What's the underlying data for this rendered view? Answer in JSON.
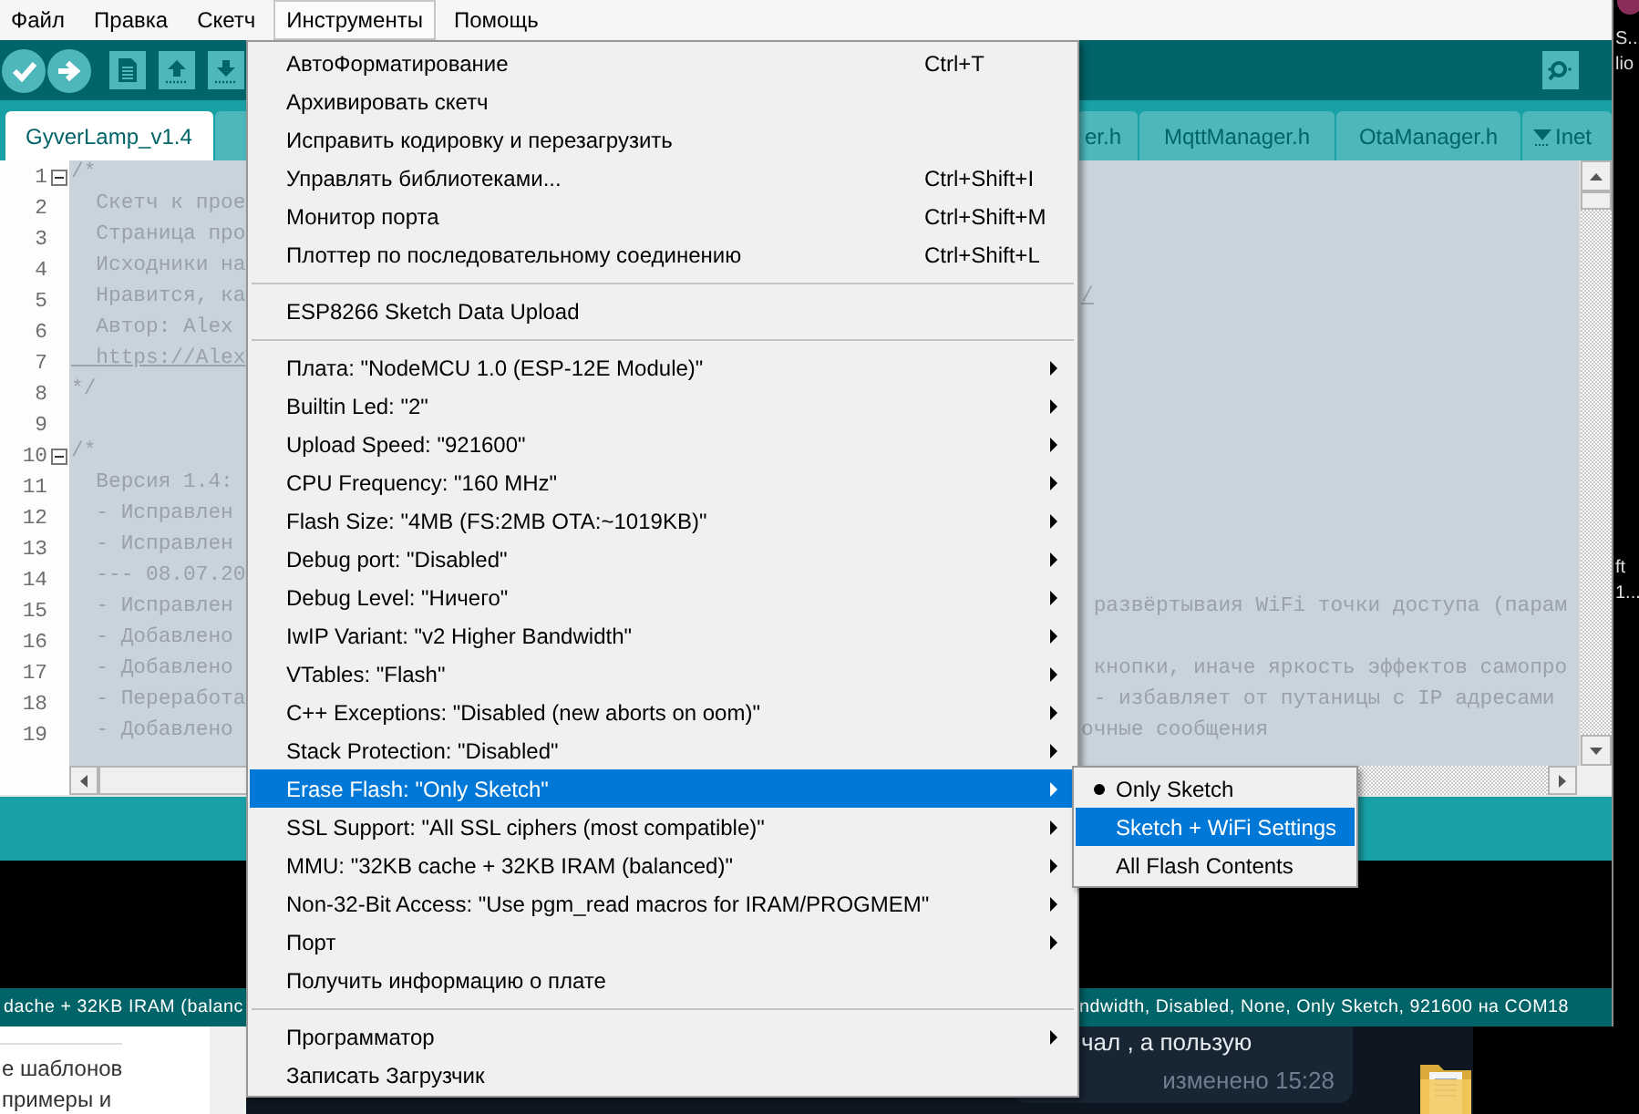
{
  "menubar": [
    {
      "label": "Файл",
      "selected": false
    },
    {
      "label": "Правка",
      "selected": false
    },
    {
      "label": "Скетч",
      "selected": false
    },
    {
      "label": "Инструменты",
      "selected": true
    },
    {
      "label": "Помощь",
      "selected": false
    }
  ],
  "tabs": [
    {
      "kind": "file",
      "label": "GyverLamp_v1.4",
      "selected": true
    },
    {
      "kind": "file",
      "selected": false
    },
    {
      "kind": "file",
      "label": "er.h",
      "selected": false
    },
    {
      "kind": "file",
      "label": "MqttManager.h",
      "selected": false
    },
    {
      "kind": "file",
      "label": "OtaManager.h",
      "selected": false
    },
    {
      "kind": "more",
      "label": "Inet",
      "selected": false
    }
  ],
  "editor": {
    "lines": [
      {
        "number": "1",
        "fold": true,
        "parts": [
          {
            "text": "/*",
            "link": false
          }
        ]
      },
      {
        "number": "2",
        "fold": false,
        "parts": [
          {
            "text": "  Скетч к прое",
            "link": false
          }
        ]
      },
      {
        "number": "3",
        "fold": false,
        "parts": [
          {
            "text": "  Страница про",
            "link": false
          }
        ]
      },
      {
        "number": "4",
        "fold": false,
        "parts": [
          {
            "text": "  Исходники на",
            "link": false
          }
        ]
      },
      {
        "number": "5",
        "fold": false,
        "parts": [
          {
            "text": "  Нравится, ка",
            "link": false
          },
          {
            "text": "/",
            "link": true
          }
        ]
      },
      {
        "number": "6",
        "fold": false,
        "parts": [
          {
            "text": "  Автор: Alex",
            "link": false
          }
        ]
      },
      {
        "number": "7",
        "fold": false,
        "parts": [
          {
            "text": "  https://Alex",
            "link": true
          }
        ]
      },
      {
        "number": "8",
        "fold": false,
        "parts": [
          {
            "text": "*/",
            "link": false
          }
        ]
      },
      {
        "number": "9",
        "fold": false
      },
      {
        "number": "10",
        "fold": true,
        "parts": [
          {
            "text": "/*",
            "link": false
          }
        ]
      },
      {
        "number": "11",
        "fold": false,
        "parts": [
          {
            "text": "  Версия 1.4:",
            "link": false
          }
        ]
      },
      {
        "number": "12",
        "fold": false,
        "parts": [
          {
            "text": "  - Исправлен",
            "link": false
          }
        ]
      },
      {
        "number": "13",
        "fold": false,
        "parts": [
          {
            "text": "  - Исправлен",
            "link": false
          }
        ]
      },
      {
        "number": "14",
        "fold": false,
        "parts": [
          {
            "text": "  --- 08.07.20",
            "link": false
          }
        ]
      },
      {
        "number": "15",
        "fold": false,
        "parts": [
          {
            "text": "  - Исправлен",
            "link": false
          },
          {
            "text": " развёртываия WiFi точки доступа (парам",
            "link": false
          }
        ]
      },
      {
        "number": "16",
        "fold": false,
        "parts": [
          {
            "text": "  - Добавлено",
            "link": false
          }
        ]
      },
      {
        "number": "17",
        "fold": false,
        "parts": [
          {
            "text": "  - Добавлено",
            "link": false
          },
          {
            "text": " кнопки, иначе яркость эффектов самопро",
            "link": false
          }
        ]
      },
      {
        "number": "18",
        "fold": false,
        "parts": [
          {
            "text": "  - Переработа",
            "link": false
          },
          {
            "text": " - избавляет от путаницы с IP адресами",
            "link": false
          }
        ]
      },
      {
        "number": "19",
        "fold": false,
        "parts": [
          {
            "text": "  - Добавлено",
            "link": false
          },
          {
            "text": "очные сообщения",
            "link": false
          }
        ]
      }
    ]
  },
  "status_bar": {
    "left": "dache + 32KB IRAM (balanc",
    "right": "ndwidth, Disabled, None, Only Sketch, 921600 на COM18"
  },
  "tools_menu": {
    "items": [
      {
        "kind": "item",
        "label": "АвтоФорматирование",
        "shortcut": "Ctrl+T",
        "submenu": false,
        "selected": false
      },
      {
        "kind": "item",
        "label": "Архивировать скетч",
        "submenu": false,
        "selected": false
      },
      {
        "kind": "item",
        "label": "Исправить кодировку и перезагрузить",
        "submenu": false,
        "selected": false
      },
      {
        "kind": "item",
        "label": "Управлять библиотеками...",
        "shortcut": "Ctrl+Shift+I",
        "submenu": false,
        "selected": false
      },
      {
        "kind": "item",
        "label": "Монитор порта",
        "shortcut": "Ctrl+Shift+M",
        "submenu": false,
        "selected": false
      },
      {
        "kind": "item",
        "label": "Плоттер по последовательному соединению",
        "shortcut": "Ctrl+Shift+L",
        "submenu": false,
        "selected": false
      },
      {
        "kind": "separator"
      },
      {
        "kind": "item",
        "label": "ESP8266 Sketch Data Upload",
        "submenu": false,
        "selected": false
      },
      {
        "kind": "separator"
      },
      {
        "kind": "item",
        "label": "Плата: \"NodeMCU 1.0 (ESP-12E Module)\"",
        "submenu": true,
        "selected": false
      },
      {
        "kind": "item",
        "label": "Builtin Led: \"2\"",
        "submenu": true,
        "selected": false
      },
      {
        "kind": "item",
        "label": "Upload Speed: \"921600\"",
        "submenu": true,
        "selected": false
      },
      {
        "kind": "item",
        "label": "CPU Frequency: \"160 MHz\"",
        "submenu": true,
        "selected": false
      },
      {
        "kind": "item",
        "label": "Flash Size: \"4MB (FS:2MB OTA:~1019KB)\"",
        "submenu": true,
        "selected": false
      },
      {
        "kind": "item",
        "label": "Debug port: \"Disabled\"",
        "submenu": true,
        "selected": false
      },
      {
        "kind": "item",
        "label": "Debug Level: \"Ничего\"",
        "submenu": true,
        "selected": false
      },
      {
        "kind": "item",
        "label": "IwIP Variant: \"v2 Higher Bandwidth\"",
        "submenu": true,
        "selected": false
      },
      {
        "kind": "item",
        "label": "VTables: \"Flash\"",
        "submenu": true,
        "selected": false
      },
      {
        "kind": "item",
        "label": "C++ Exceptions: \"Disabled (new aborts on oom)\"",
        "submenu": true,
        "selected": false
      },
      {
        "kind": "item",
        "label": "Stack Protection: \"Disabled\"",
        "submenu": true,
        "selected": false
      },
      {
        "kind": "item",
        "label": "Erase Flash: \"Only Sketch\"",
        "submenu": true,
        "selected": true
      },
      {
        "kind": "item",
        "label": "SSL Support: \"All SSL ciphers (most compatible)\"",
        "submenu": true,
        "selected": false
      },
      {
        "kind": "item",
        "label": "MMU: \"32KB cache + 32KB IRAM (balanced)\"",
        "submenu": true,
        "selected": false
      },
      {
        "kind": "item",
        "label": "Non-32-Bit Access: \"Use pgm_read macros for IRAM/PROGMEM\"",
        "submenu": true,
        "selected": false
      },
      {
        "kind": "item",
        "label": "Порт",
        "submenu": true,
        "selected": false
      },
      {
        "kind": "item",
        "label": "Получить информацию о плате",
        "submenu": false,
        "selected": false
      },
      {
        "kind": "separator"
      },
      {
        "kind": "item",
        "label": "Программатор",
        "submenu": true,
        "selected": false
      },
      {
        "kind": "item",
        "label": "Записать Загрузчик",
        "submenu": false,
        "selected": false
      }
    ]
  },
  "erase_flash_menu": {
    "items": [
      {
        "label": "Only Sketch",
        "checked": true,
        "selected": false
      },
      {
        "label": "Sketch + WiFi Settings",
        "checked": false,
        "selected": true
      },
      {
        "label": "All Flash Contents",
        "checked": false,
        "selected": false
      }
    ]
  },
  "desktop": {
    "edge_texts": [
      [
        "S..",
        "lio"
      ],
      [
        "ft",
        "1..."
      ]
    ],
    "side_panel": [
      "е шаблонов",
      "примеры и"
    ],
    "chat": {
      "text": "чал , а пользую",
      "time": "изменено 15:28"
    }
  }
}
